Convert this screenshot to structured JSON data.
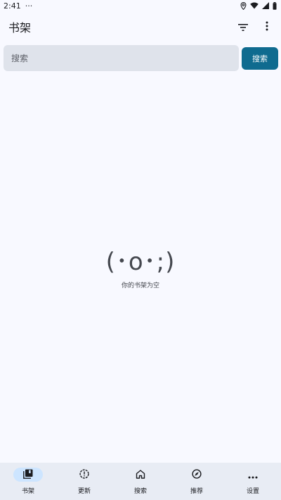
{
  "status_bar": {
    "time": "2:41",
    "dots": "···"
  },
  "app_bar": {
    "title": "书架",
    "filter_icon": "filter-icon",
    "more_icon": "more-vert-icon"
  },
  "search": {
    "placeholder": "搜索",
    "button_label": "搜索"
  },
  "empty_state": {
    "kaomoji": "(･o･;)",
    "message": "你的书架为空"
  },
  "bottom_nav": {
    "items": [
      {
        "label": "书架",
        "icon": "library-icon",
        "active": true
      },
      {
        "label": "更新",
        "icon": "updates-icon",
        "active": false
      },
      {
        "label": "搜索",
        "icon": "home-icon",
        "active": false
      },
      {
        "label": "推荐",
        "icon": "explore-icon",
        "active": false
      },
      {
        "label": "设置",
        "icon": "more-horiz-icon",
        "active": false
      }
    ]
  },
  "colors": {
    "background": "#f8f9ff",
    "accent": "#0f6b8f",
    "search_field": "#dfe3eb",
    "nav_background": "#e8ecf4",
    "nav_active_pill": "#cde5ff"
  }
}
